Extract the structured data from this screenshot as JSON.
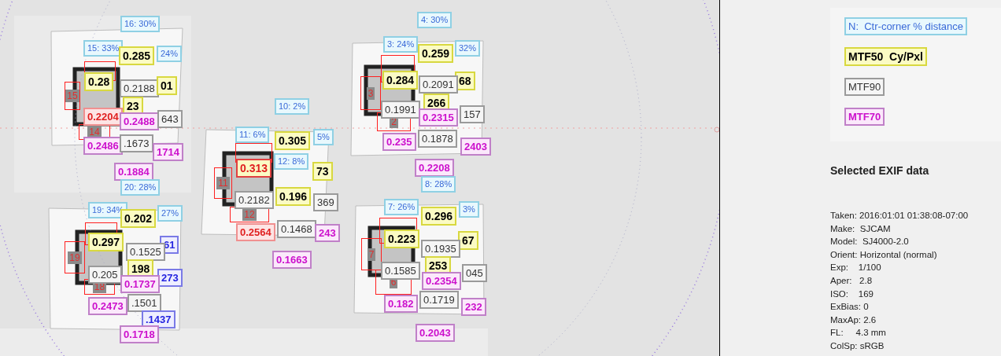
{
  "overlay_labels": [
    {
      "kind": "pct",
      "text": "16: 30%",
      "flagged": false
    },
    {
      "kind": "pct",
      "text": "15: 33%",
      "flagged": false
    },
    {
      "kind": "mtf50",
      "text": "0.285",
      "flagged": false
    },
    {
      "kind": "pct",
      "text": "24%",
      "flagged": false
    },
    {
      "kind": "mtf50",
      "text": "0.28",
      "flagged": false
    },
    {
      "kind": "mtf90",
      "text": "0.2188",
      "flagged": false
    },
    {
      "kind": "mtf50",
      "text": "01",
      "flagged": false
    },
    {
      "kind": "mtf50",
      "text": "23",
      "flagged": false
    },
    {
      "kind": "mtf70",
      "text": "0.2204",
      "flagged": true
    },
    {
      "kind": "mtf70",
      "text": "0.2488",
      "flagged": false
    },
    {
      "kind": "mtf90",
      "text": "643",
      "flagged": false
    },
    {
      "kind": "mtf70",
      "text": "0.2486",
      "flagged": false
    },
    {
      "kind": "mtf90",
      "text": ".1673",
      "flagged": false
    },
    {
      "kind": "mtf70",
      "text": "1714",
      "flagged": false
    },
    {
      "kind": "mtf70",
      "text": "0.1884",
      "flagged": false
    },
    {
      "kind": "pct",
      "text": "20: 28%",
      "flagged": false
    },
    {
      "kind": "pct",
      "text": "19: 34%",
      "flagged": false
    },
    {
      "kind": "pct",
      "text": "27%",
      "flagged": false
    },
    {
      "kind": "mtf50",
      "text": "0.202",
      "flagged": false
    },
    {
      "kind": "mtf50",
      "text": "0.297",
      "flagged": false
    },
    {
      "kind": "blue",
      "text": "61",
      "flagged": false
    },
    {
      "kind": "mtf90",
      "text": "0.1525",
      "flagged": false
    },
    {
      "kind": "mtf50",
      "text": "198",
      "flagged": false
    },
    {
      "kind": "mtf90",
      "text": "0.205",
      "flagged": false
    },
    {
      "kind": "blue",
      "text": "273",
      "flagged": false
    },
    {
      "kind": "mtf70",
      "text": "0.1737",
      "flagged": false
    },
    {
      "kind": "mtf70",
      "text": "0.2473",
      "flagged": false
    },
    {
      "kind": "mtf90",
      "text": ".1501",
      "flagged": false
    },
    {
      "kind": "blue",
      "text": ".1437",
      "flagged": false
    },
    {
      "kind": "mtf70",
      "text": "0.1718",
      "flagged": false
    },
    {
      "kind": "pct",
      "text": "10: 2%",
      "flagged": false
    },
    {
      "kind": "pct",
      "text": "11: 6%",
      "flagged": false
    },
    {
      "kind": "pct",
      "text": "5%",
      "flagged": false
    },
    {
      "kind": "mtf50",
      "text": "0.305",
      "flagged": false
    },
    {
      "kind": "pct",
      "text": "12: 8%",
      "flagged": false
    },
    {
      "kind": "mtf50",
      "text": "0.313",
      "flagged": true
    },
    {
      "kind": "mtf50",
      "text": "73",
      "flagged": false
    },
    {
      "kind": "mtf90",
      "text": "0.2182",
      "flagged": false
    },
    {
      "kind": "mtf50",
      "text": "0.196",
      "flagged": false
    },
    {
      "kind": "mtf90",
      "text": "369",
      "flagged": false
    },
    {
      "kind": "mtf70",
      "text": "0.2564",
      "flagged": true
    },
    {
      "kind": "mtf90",
      "text": "0.1468",
      "flagged": false
    },
    {
      "kind": "mtf70",
      "text": "243",
      "flagged": false
    },
    {
      "kind": "mtf70",
      "text": "0.1663",
      "flagged": false
    },
    {
      "kind": "pct",
      "text": "4: 30%",
      "flagged": false
    },
    {
      "kind": "pct",
      "text": "3: 24%",
      "flagged": false
    },
    {
      "kind": "pct",
      "text": "32%",
      "flagged": false
    },
    {
      "kind": "mtf50",
      "text": "0.259",
      "flagged": false
    },
    {
      "kind": "mtf50",
      "text": "0.284",
      "flagged": false
    },
    {
      "kind": "mtf50",
      "text": "68",
      "flagged": false
    },
    {
      "kind": "mtf90",
      "text": "0.2091",
      "flagged": false
    },
    {
      "kind": "mtf90",
      "text": "0.1991",
      "flagged": false
    },
    {
      "kind": "mtf50",
      "text": "266",
      "flagged": false
    },
    {
      "kind": "mtf90",
      "text": "157",
      "flagged": false
    },
    {
      "kind": "mtf70",
      "text": "0.2315",
      "flagged": false
    },
    {
      "kind": "mtf70",
      "text": "0.235",
      "flagged": false
    },
    {
      "kind": "mtf90",
      "text": "0.1878",
      "flagged": false
    },
    {
      "kind": "mtf70",
      "text": "2403",
      "flagged": false
    },
    {
      "kind": "mtf70",
      "text": "0.2208",
      "flagged": false
    },
    {
      "kind": "pct",
      "text": "8: 28%",
      "flagged": false
    },
    {
      "kind": "pct",
      "text": "7: 26%",
      "flagged": false
    },
    {
      "kind": "pct",
      "text": "3%",
      "flagged": false
    },
    {
      "kind": "mtf50",
      "text": "0.296",
      "flagged": false
    },
    {
      "kind": "mtf50",
      "text": "0.223",
      "flagged": false
    },
    {
      "kind": "mtf50",
      "text": "67",
      "flagged": false
    },
    {
      "kind": "mtf90",
      "text": "0.1935",
      "flagged": false
    },
    {
      "kind": "mtf90",
      "text": "0.1585",
      "flagged": false
    },
    {
      "kind": "mtf50",
      "text": "253",
      "flagged": false
    },
    {
      "kind": "mtf90",
      "text": "045",
      "flagged": false
    },
    {
      "kind": "mtf70",
      "text": "0.2354",
      "flagged": false
    },
    {
      "kind": "mtf70",
      "text": "0.182",
      "flagged": false
    },
    {
      "kind": "mtf90",
      "text": "0.1719",
      "flagged": false
    },
    {
      "kind": "mtf70",
      "text": "232",
      "flagged": false
    },
    {
      "kind": "mtf70",
      "text": "0.2043",
      "flagged": false
    }
  ],
  "region_markers": [
    {
      "text": "15"
    },
    {
      "text": "14"
    },
    {
      "text": "19"
    },
    {
      "text": "18"
    },
    {
      "text": "11"
    },
    {
      "text": "12"
    },
    {
      "text": "3"
    },
    {
      "text": "2"
    },
    {
      "text": "7"
    },
    {
      "text": "6"
    }
  ],
  "legend": [
    {
      "kind": "pct",
      "text": "N:  Ctr-corner % distance"
    },
    {
      "kind": "mtf50",
      "text": "MTF50  Cy/Pxl"
    },
    {
      "kind": "mtf90",
      "text": "MTF90"
    },
    {
      "kind": "mtf70",
      "text": "MTF70"
    }
  ],
  "exif": {
    "title": "Selected EXIF data",
    "lines": [
      "Taken: 2016:01:01 01:38:08-07:00",
      "Make:  SJCAM",
      "Model:  SJ4000-2.0",
      "Orient: Horizontal (normal)",
      "Exp:    1/100",
      "Aper:   2.8",
      "ISO:    169",
      "ExBias: 0",
      "MaxAp: 2.6",
      "FL:     4.3 mm",
      "ColSp: sRGB"
    ]
  }
}
